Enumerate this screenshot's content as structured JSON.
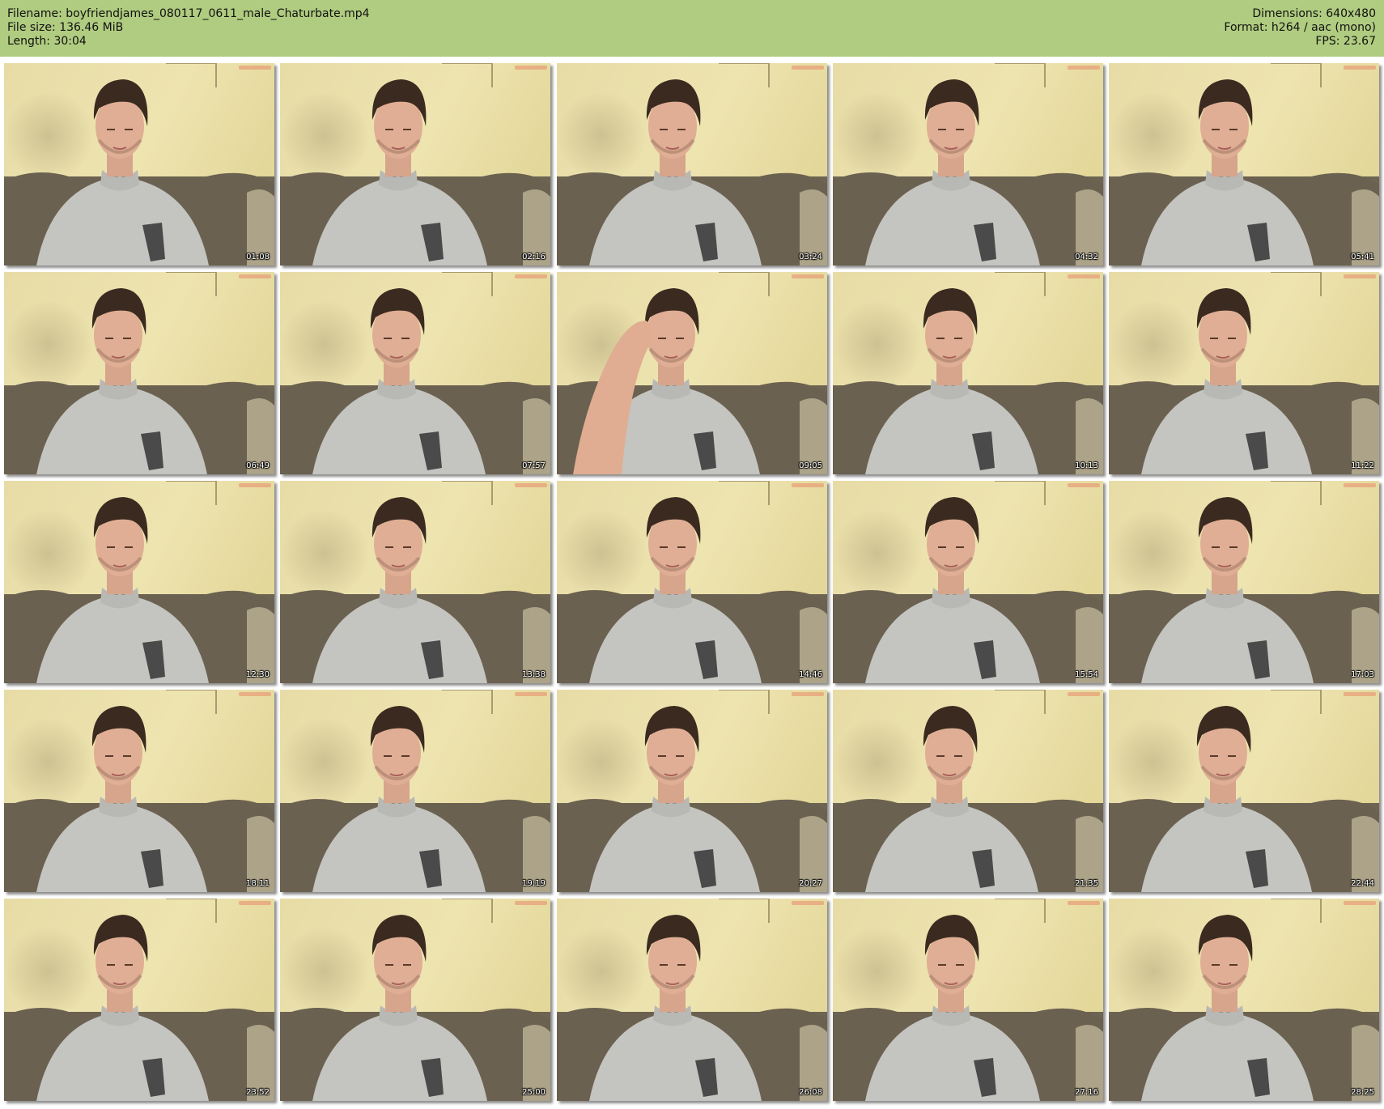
{
  "file_info": {
    "filename": "Filename: boyfriendjames_080117_0611_male_Chaturbate.mp4",
    "file_size": "File size: 136.46 MiB",
    "length": "Length: 30:04",
    "dimensions": "Dimensions: 640x480",
    "format": "Format: h264 / aac (mono)",
    "fps": "FPS: 23.67"
  },
  "colors": {
    "header_background": "#b0cc80",
    "wall": "#e9dfa8",
    "sofa": "#6e6452",
    "shirt": "#c4c4c0",
    "pocket": "#4a4a4a"
  },
  "thumbnails": [
    {
      "timestamp": "01:08"
    },
    {
      "timestamp": "02:16"
    },
    {
      "timestamp": "03:24"
    },
    {
      "timestamp": "04:32"
    },
    {
      "timestamp": "05:41"
    },
    {
      "timestamp": "06:49"
    },
    {
      "timestamp": "07:57"
    },
    {
      "timestamp": "09:05"
    },
    {
      "timestamp": "10:13"
    },
    {
      "timestamp": "11:22"
    },
    {
      "timestamp": "12:30"
    },
    {
      "timestamp": "13:38"
    },
    {
      "timestamp": "14:46"
    },
    {
      "timestamp": "15:54"
    },
    {
      "timestamp": "17:03"
    },
    {
      "timestamp": "18:11"
    },
    {
      "timestamp": "19:19"
    },
    {
      "timestamp": "20:27"
    },
    {
      "timestamp": "21:35"
    },
    {
      "timestamp": "22:44"
    },
    {
      "timestamp": "23:52"
    },
    {
      "timestamp": "25:00"
    },
    {
      "timestamp": "26:08"
    },
    {
      "timestamp": "27:16"
    },
    {
      "timestamp": "28:25"
    }
  ]
}
